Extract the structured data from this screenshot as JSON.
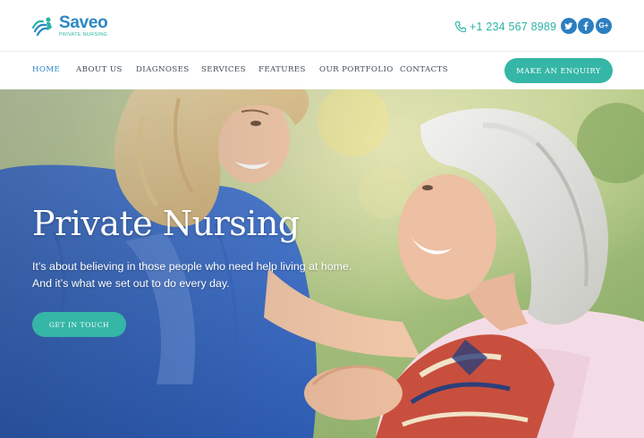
{
  "brand": {
    "name": "Saveo",
    "tagline": "PRIVATE NURSING",
    "primary_color": "#2a87c6",
    "accent_color": "#35b6a6"
  },
  "header": {
    "phone": "+1 234 567 8989",
    "social": [
      "twitter-icon",
      "facebook-icon",
      "google-plus-icon"
    ]
  },
  "nav": {
    "items": [
      {
        "label": "HOME",
        "active": true
      },
      {
        "label": "ABOUT US"
      },
      {
        "label": "DIAGNOSES"
      },
      {
        "label": "SERVICES"
      },
      {
        "label": "FEATURES"
      },
      {
        "label": "OUR PORTFOLIO"
      },
      {
        "label": "CONTACTS"
      }
    ],
    "cta_label": "MAKE AN ENQUIRY"
  },
  "hero": {
    "title": "Private Nursing",
    "text_line1": "It’s about believing in those people who need help living at home.",
    "text_line2": "And it’s what we set out to do every day.",
    "button_label": "GET IN TOUCH"
  }
}
